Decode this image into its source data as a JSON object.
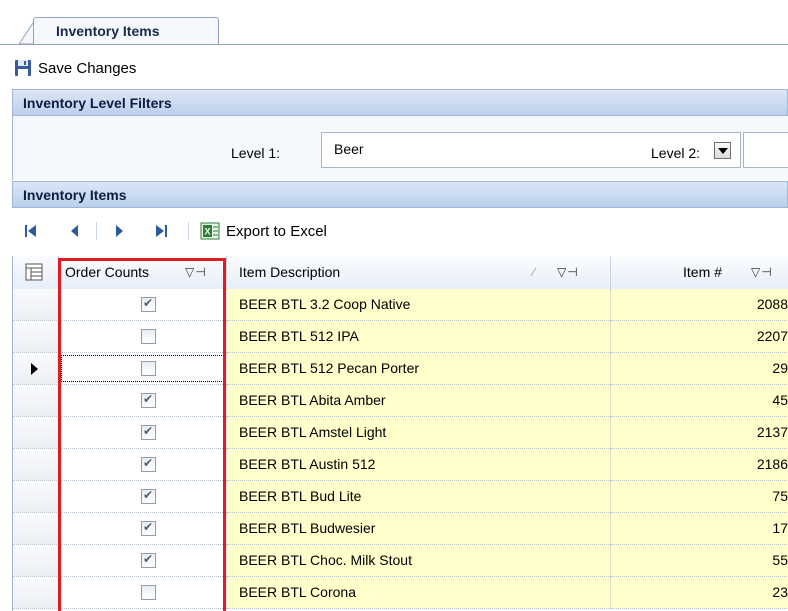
{
  "tab": {
    "label": "Inventory Items"
  },
  "toolbar": {
    "save_label": "Save Changes"
  },
  "filters_section": {
    "title": "Inventory Level Filters",
    "level1_label": "Level 1:",
    "level1_value": "Beer",
    "level2_label": "Level 2:"
  },
  "items_section": {
    "title": "Inventory Items"
  },
  "navigator": {
    "export_label": "Export to Excel"
  },
  "grid": {
    "columns": [
      "Order Counts",
      "Item Description",
      "Item #"
    ],
    "rows": [
      {
        "order_counts": true,
        "description": "BEER BTL 3.2 Coop Native",
        "item_no": "2088"
      },
      {
        "order_counts": false,
        "description": "BEER BTL 512 IPA",
        "item_no": "2207"
      },
      {
        "order_counts": false,
        "description": "BEER BTL 512 Pecan Porter",
        "item_no": "29"
      },
      {
        "order_counts": true,
        "description": "BEER BTL Abita Amber",
        "item_no": "45"
      },
      {
        "order_counts": true,
        "description": "BEER BTL Amstel Light",
        "item_no": "2137"
      },
      {
        "order_counts": true,
        "description": "BEER BTL Austin 512",
        "item_no": "2186"
      },
      {
        "order_counts": true,
        "description": "BEER BTL Bud Lite",
        "item_no": "75"
      },
      {
        "order_counts": true,
        "description": "BEER BTL Budwesier",
        "item_no": "17"
      },
      {
        "order_counts": true,
        "description": "BEER BTL Choc. Milk Stout",
        "item_no": "55"
      },
      {
        "order_counts": false,
        "description": "BEER BTL Corona",
        "item_no": "23"
      }
    ],
    "current_row": 2
  },
  "colors": {
    "highlight": "#e01b24",
    "row_background": "#ffffcc",
    "header_blue": "#bcd0ec"
  }
}
